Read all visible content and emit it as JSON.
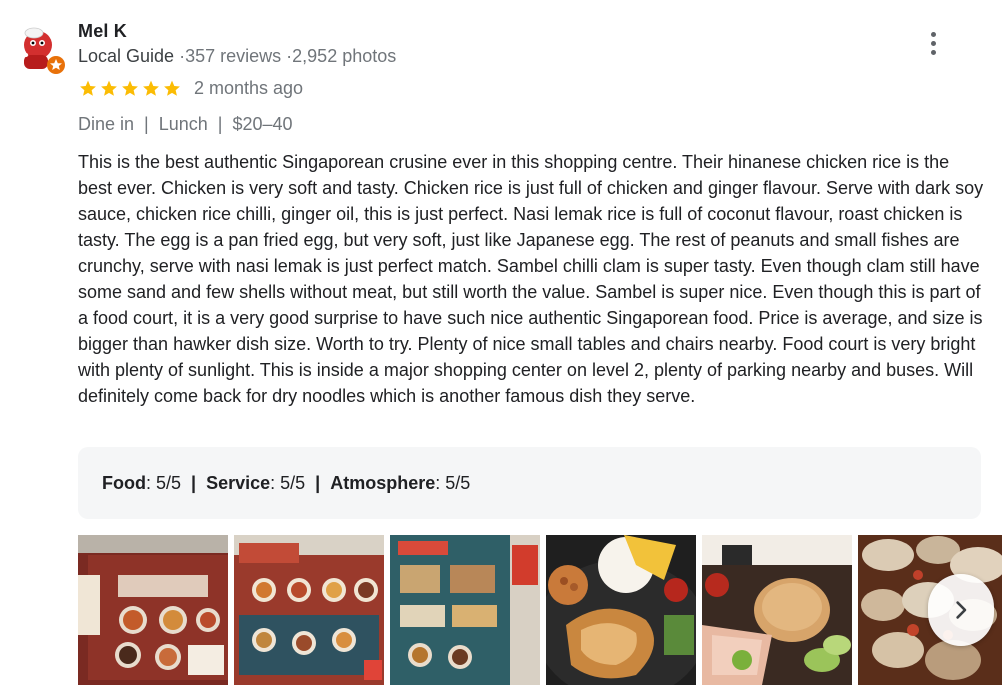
{
  "reviewer": {
    "name": "Mel K",
    "badge": "Local Guide",
    "reviews": "357 reviews",
    "photos": "2,952 photos",
    "separator": "·"
  },
  "review": {
    "stars": 5,
    "time": "2 months ago",
    "meta": [
      "Dine in",
      "Lunch",
      "$20–40"
    ],
    "meta_separator": "|",
    "text": "This is the best authentic Singaporean crusine ever in this shopping centre. Their hinanese chicken rice is the best ever. Chicken is very soft and tasty. Chicken rice is just full of chicken and ginger flavour. Serve with dark soy sauce, chicken rice chilli, ginger oil, this is just perfect. Nasi lemak rice is full of coconut flavour, roast chicken is tasty. The egg is a pan fried egg, but very soft, just like Japanese egg. The rest of peanuts and small fishes are crunchy, serve with nasi lemak is just perfect match. Sambel chilli clam is super tasty. Even though clam still have some sand and few shells without meat, but still worth the value. Sambel is super nice. Even though this is part of a food court, it is a very good surprise to have such nice authentic Singaporean food. Price is average, and size is bigger than hawker dish size. Worth to try. Plenty of nice small tables and chairs nearby. Food court is very bright with  plenty of sunlight. This is inside a major shopping center on level 2, plenty of parking nearby and buses. Will definitely come back for dry noodles which is another famous dish they serve."
  },
  "attributes": {
    "food_label": "Food",
    "food_value": ": 5/5",
    "service_label": "Service",
    "service_value": ": 5/5",
    "atmosphere_label": "Atmosphere",
    "atmosphere_value": ": 5/5",
    "separator": "|"
  },
  "photos": [
    {
      "subject": "menu board"
    },
    {
      "subject": "menu board"
    },
    {
      "subject": "menu board"
    },
    {
      "subject": "nasi lemak plate"
    },
    {
      "subject": "chicken rice plate"
    },
    {
      "subject": "sambal clams"
    }
  ],
  "colors": {
    "star": "#fbbc04",
    "muted_text": "#70757a",
    "attr_bg": "#f5f6f7"
  },
  "icons": {
    "more": "more-vert-icon",
    "next": "chevron-right-icon",
    "star": "star-icon"
  }
}
